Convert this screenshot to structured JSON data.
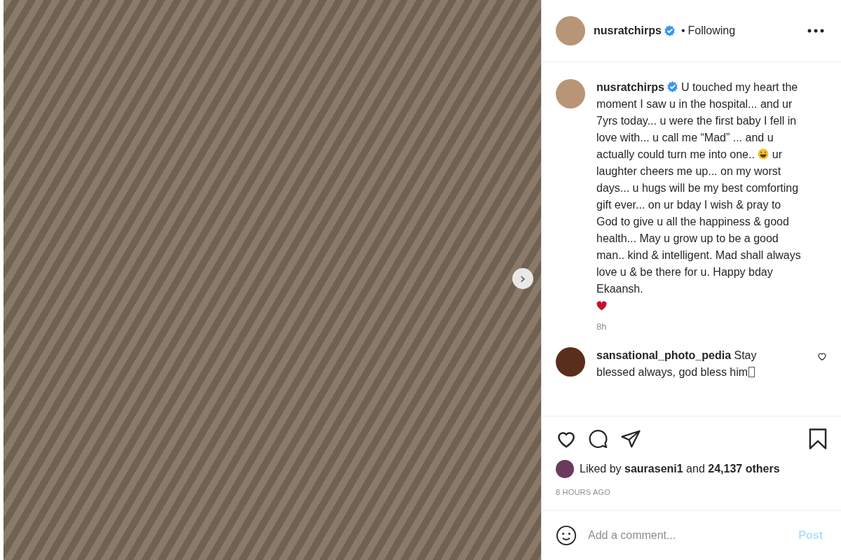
{
  "post": {
    "next_button": "›"
  },
  "header": {
    "username": "nusratchirps",
    "separator": "•",
    "follow_status": "Following"
  },
  "caption": {
    "username": "nusratchirps",
    "text_before_emoji": "U touched my heart the moment I saw u in the hospital... and ur 7yrs today... u were the first baby I fell in love with... u call me “Mad” ... and u actually could turn me into one..",
    "text_after_emoji": "ur laughter cheers me up... on my worst days... u hugs will be my best comforting gift ever... on ur bday I wish & pray to God to give u all the happiness & good health... May u grow up to be a good man.. kind & intelligent. Mad shall always love u & be there for u. Happy bday Ekaansh.",
    "time": "8h"
  },
  "comments": [
    {
      "username": "sansational_photo_pedia",
      "text": "Stay blessed always, god bless him",
      "liked": false
    }
  ],
  "actions": {
    "liked": false,
    "saved": false
  },
  "likes": {
    "prefix": "Liked by",
    "user": "sauraseni1",
    "middle": "and",
    "count": "24,137 others"
  },
  "timestamp": "8 HOURS AGO",
  "comment_box": {
    "placeholder": "Add a comment...",
    "post_button": "Post"
  }
}
